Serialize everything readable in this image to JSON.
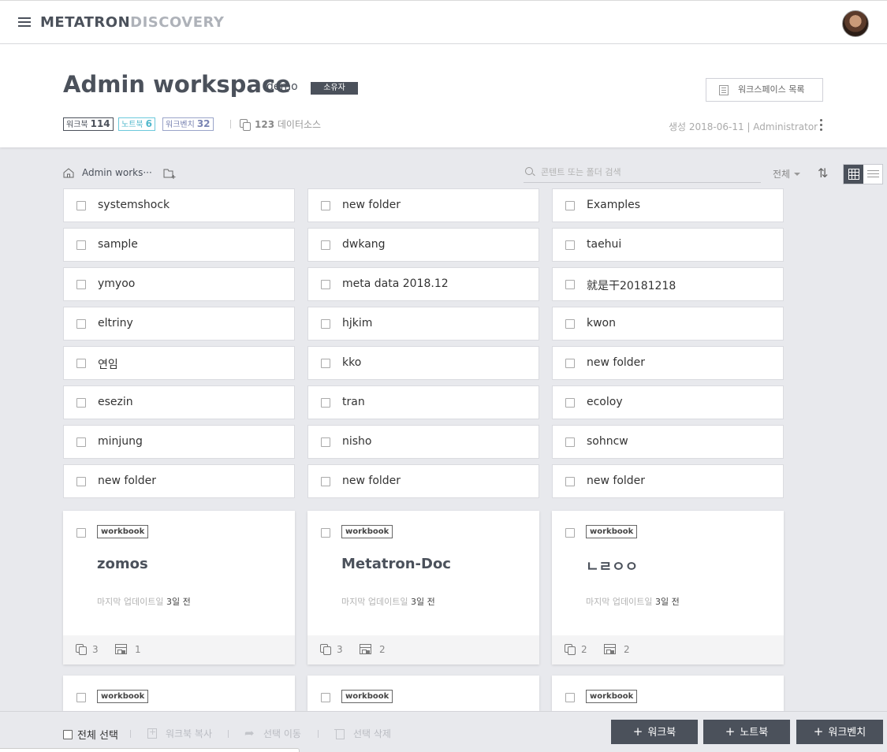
{
  "nav": {
    "logo_primary": "METATRON",
    "logo_secondary": "DISCOVERY"
  },
  "workspace": {
    "title": "Admin workspace",
    "owner": "demo",
    "role": "소유자",
    "list_button": "워크스페이스 목록",
    "counts": [
      {
        "label": "워크북",
        "value": "114"
      },
      {
        "label": "노트북",
        "value": "6"
      },
      {
        "label": "워크벤치",
        "value": "32"
      }
    ],
    "datasource_count": "123",
    "datasource_label": "데이터소스",
    "created_info": "생성 2018-06-11 | Administrator"
  },
  "toolbar": {
    "breadcrumb": "Admin works···",
    "search_placeholder": "콘텐트 또는 폴더 검색",
    "filter_label": "전체",
    "sort_icon": "⇅"
  },
  "folders": [
    [
      "systemshock",
      "new folder",
      "Examples"
    ],
    [
      "sample",
      "dwkang",
      "taehui"
    ],
    [
      "ymyoo",
      "meta data 2018.12",
      "就是干20181218"
    ],
    [
      "eltriny",
      "hjkim",
      "kwon"
    ],
    [
      "연임",
      "kko",
      "new folder"
    ],
    [
      "esezin",
      "tran",
      "ecoloy"
    ],
    [
      "minjung",
      "nisho",
      "sohncw"
    ],
    [
      "new folder",
      "new folder",
      "new folder"
    ]
  ],
  "workbooks": [
    {
      "tag": "workbook",
      "name": "zomos",
      "updated_label": "마지막 업데이트일",
      "updated_value": "3일 전",
      "datasources": "3",
      "dashboards": "1"
    },
    {
      "tag": "workbook",
      "name": "Metatron-Doc",
      "updated_label": "마지막 업데이트일",
      "updated_value": "3일 전",
      "datasources": "3",
      "dashboards": "2"
    },
    {
      "tag": "workbook",
      "name": "ㄴㄹㅇㅇ",
      "updated_label": "마지막 업데이트일",
      "updated_value": "3일 전",
      "datasources": "2",
      "dashboards": "2"
    }
  ],
  "workbooks_row2": [
    {
      "tag": "workbook"
    },
    {
      "tag": "workbook"
    },
    {
      "tag": "workbook"
    }
  ],
  "bottombar": {
    "select_all": "전체 선택",
    "copy_workbook": "워크북 복사",
    "move_selected": "선택 이동",
    "delete_selected": "선택 삭제",
    "create_workbook": "워크북",
    "create_notebook": "노트북",
    "create_workbench": "워크벤치"
  }
}
